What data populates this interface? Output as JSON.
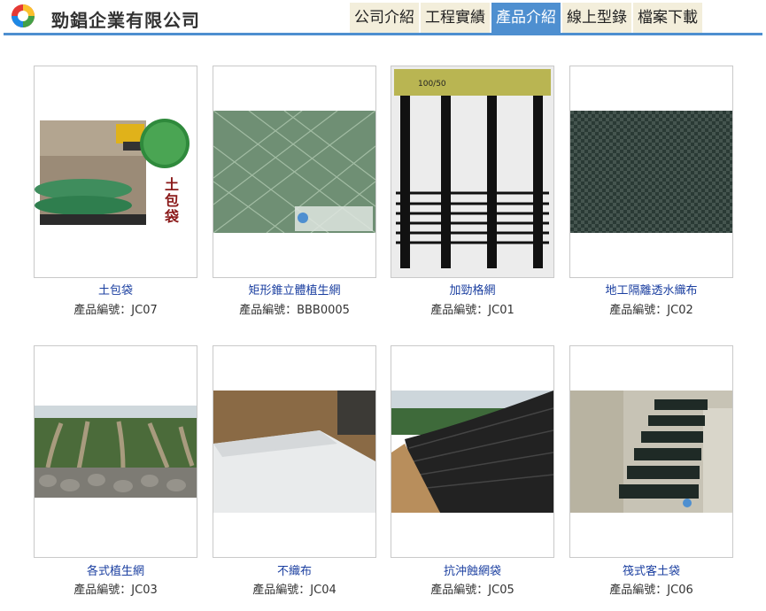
{
  "header": {
    "company_name": "勁錩企業有限公司",
    "nav": [
      "公司介紹",
      "工程實績",
      "產品介紹",
      "線上型錄",
      "檔案下載"
    ],
    "active_nav": "產品介紹"
  },
  "colors": {
    "accent": "#4e8fd0",
    "nav_bg": "#f3eedb",
    "product_link": "#1b3fa0"
  },
  "code_label": "產品編號：",
  "products": [
    {
      "name": "土包袋",
      "code": "JC07",
      "image_text": "土\n包\n袋"
    },
    {
      "name": "矩形錐立體植生網",
      "code": "BBB0005"
    },
    {
      "name": "加勁格網",
      "code": "JC01",
      "image_text": "100/50"
    },
    {
      "name": "地工隔離透水織布",
      "code": "JC02"
    },
    {
      "name": "各式植生網",
      "code": "JC03"
    },
    {
      "name": "不織布",
      "code": "JC04"
    },
    {
      "name": "抗沖蝕網袋",
      "code": "JC05"
    },
    {
      "name": "筏式客土袋",
      "code": "JC06"
    }
  ]
}
